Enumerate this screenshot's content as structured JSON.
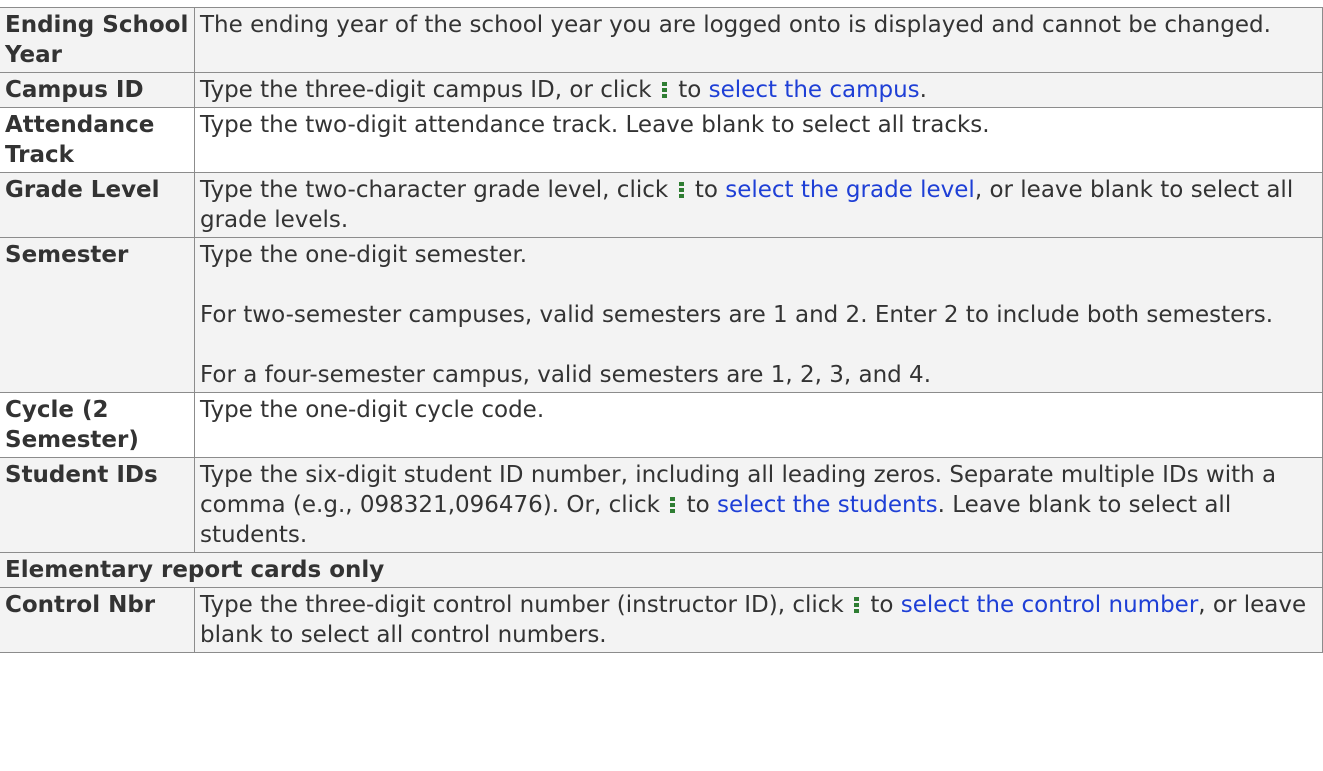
{
  "rows": {
    "ending_school_year": {
      "label": "Ending School Year",
      "text": "The ending year of the school year you are logged onto is displayed and cannot be changed."
    },
    "campus_id": {
      "label": "Campus ID",
      "pre": "Type the three-digit campus ID, or click",
      "mid": "to",
      "link": "select the campus",
      "post": "."
    },
    "attendance_track": {
      "label": "Attendance Track",
      "text": "Type the two-digit attendance track. Leave blank to select all tracks."
    },
    "grade_level": {
      "label": "Grade Level",
      "pre": "Type the two-character grade level, click",
      "mid": "to",
      "link": "select the grade level",
      "post": ", or leave blank to select all grade levels."
    },
    "semester": {
      "label": "Semester",
      "p1": "Type the one-digit semester.",
      "p2": "For two-semester campuses, valid semesters are 1 and 2. Enter 2 to include both semesters.",
      "p3": "For a four-semester campus, valid semesters are 1, 2, 3, and 4."
    },
    "cycle": {
      "label": "Cycle (2 Semester)",
      "text": "Type the one-digit cycle code."
    },
    "student_ids": {
      "label": "Student IDs",
      "pre": "Type the six-digit student ID number, including all leading zeros. Separate multiple IDs with a comma (e.g., 098321,096476). Or, click",
      "mid": "to",
      "link": "select the students",
      "post": ". Leave blank to select all students."
    },
    "section_elementary": {
      "label": "Elementary report cards only"
    },
    "control_nbr": {
      "label": "Control Nbr",
      "pre": "Type the three-digit control number (instructor ID), click",
      "mid": "to",
      "link": "select the control number",
      "post": ", or leave blank to select all control numbers."
    }
  },
  "icons": {
    "lookup": "kebab-lookup-icon",
    "lookup_color": "#2e7d32"
  },
  "colors": {
    "link": "#1e3fd6",
    "row_shade": "#f3f3f3",
    "border": "#8c8c8c"
  }
}
